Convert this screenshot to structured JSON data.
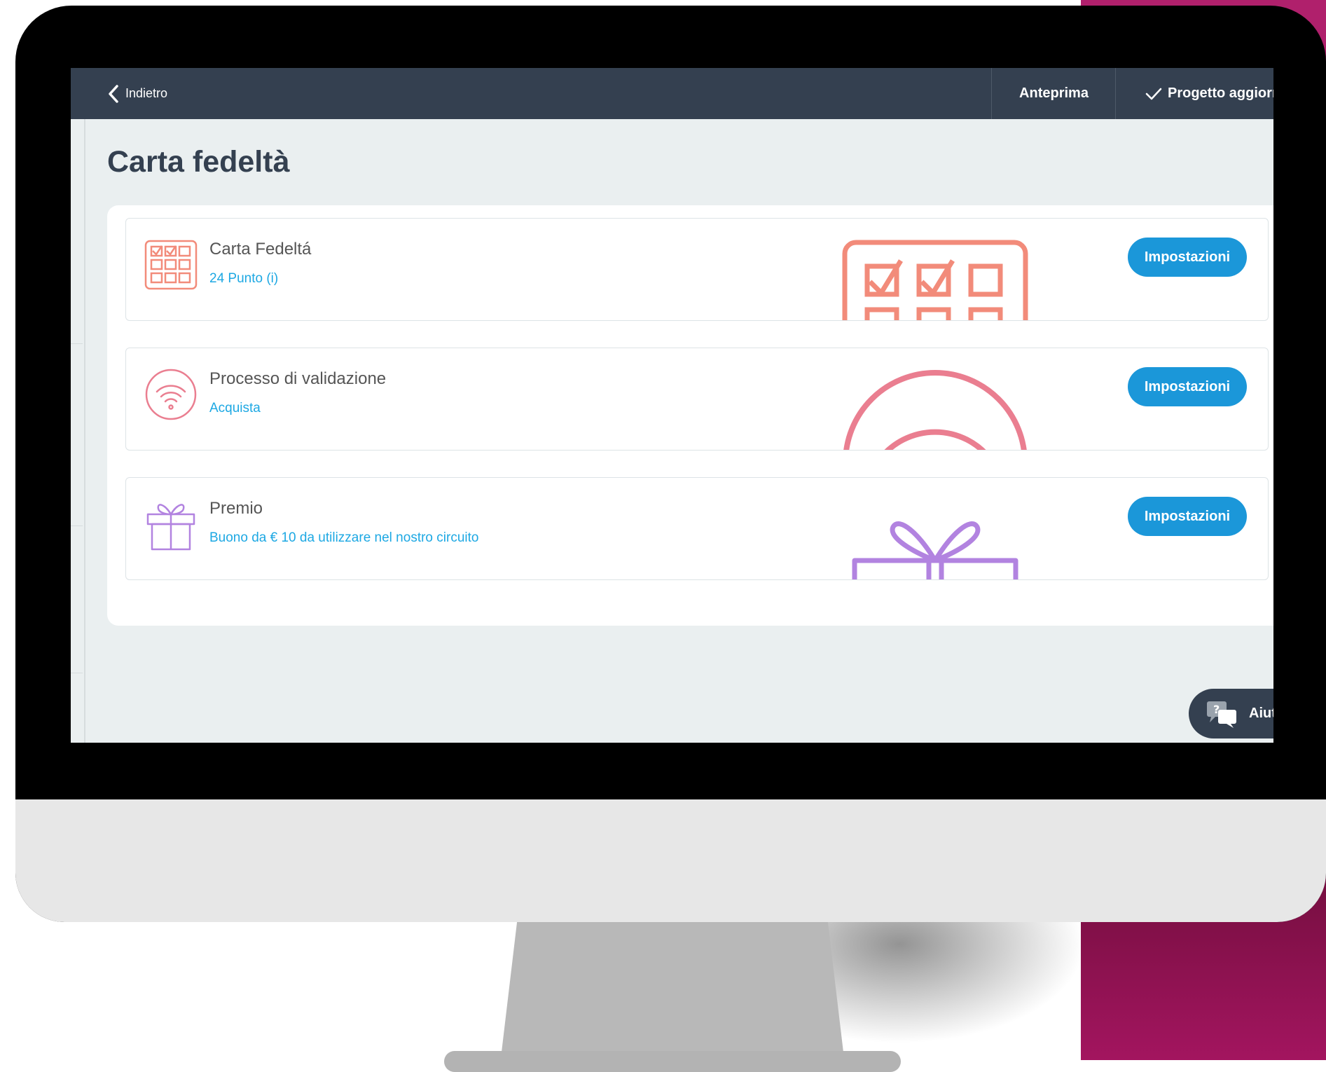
{
  "colors": {
    "background_accent": "#a11763",
    "topbar": "#344050",
    "primary_button": "#1b97d9",
    "link_text": "#1da8e3",
    "loyalty_icon": "#f28b7a",
    "validation_icon": "#ea7e90",
    "reward_icon": "#b283e0"
  },
  "topbar": {
    "back_label": "Indietro",
    "preview_label": "Anteprima",
    "status_label": "Progetto aggiornat"
  },
  "page": {
    "title": "Carta fedeltà"
  },
  "cards": [
    {
      "icon": "stamp-card-icon",
      "title": "Carta Fedeltá",
      "subtitle": "24 Punto (i)",
      "button_label": "Impostazioni"
    },
    {
      "icon": "wifi-signal-icon",
      "title": "Processo di validazione",
      "subtitle": "Acquista",
      "button_label": "Impostazioni"
    },
    {
      "icon": "gift-icon",
      "title": "Premio",
      "subtitle": "Buono da € 10 da utilizzare nel nostro circuito",
      "button_label": "Impostazioni"
    }
  ],
  "help": {
    "label": "Aiuto",
    "icon": "help-chat-icon"
  }
}
